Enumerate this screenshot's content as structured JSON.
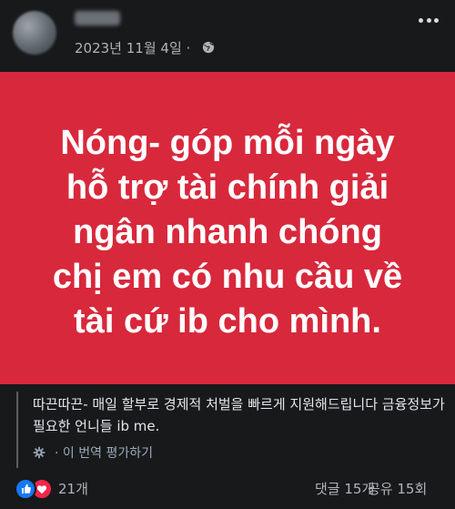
{
  "post": {
    "author_name": "",
    "timestamp": "2023년 11월 4일 ·",
    "privacy_icon": "globe-icon",
    "more_icon": "more-options-icon",
    "image_text": "Nóng- góp mỗi ngày\nhỗ trợ tài chính giải\nngân nhanh chóng\nchị em có nhu cầu về\ntài cứ ib cho mình.",
    "image_background_color": "#d8283c",
    "caption": "따끈따끈- 매일 할부로 경제적 처벌을 빠르게 지원해드립니다 금융정보가 필요한 언니들 ib me.",
    "translate_label": "· 이 번역 평가하기",
    "translate_icon": "gear-icon"
  },
  "reactions": {
    "icons": [
      "like-icon",
      "love-icon"
    ],
    "count": "21개",
    "comments": "댓글 15개",
    "shares": "공유 15회"
  },
  "colors": {
    "page_background": "#18191a",
    "accent_like": "#1877f2",
    "accent_love": "#f0284a",
    "secondary_text": "#b0b3b8"
  }
}
